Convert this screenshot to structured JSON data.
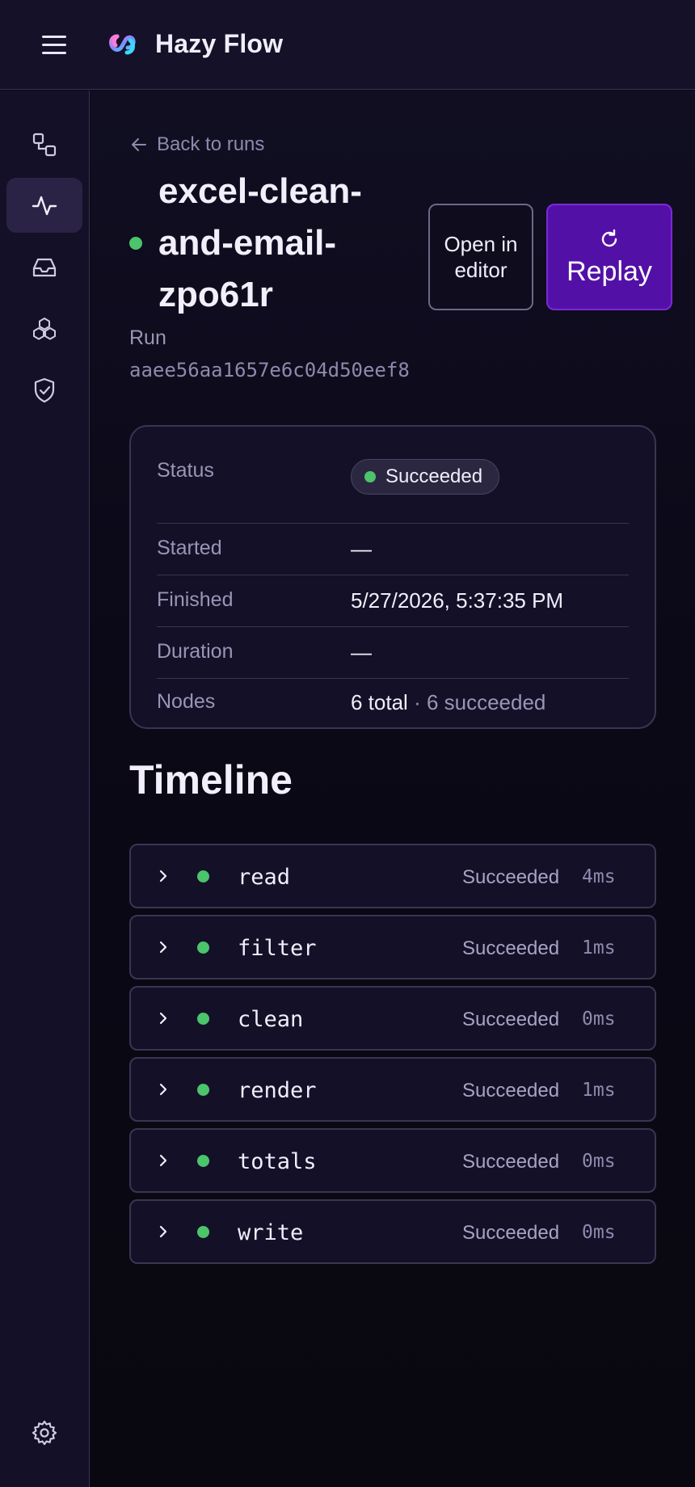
{
  "app": {
    "name": "Hazy Flow"
  },
  "sidebar": {
    "items": [
      {
        "icon": "workflows-icon",
        "label": "Workflows"
      },
      {
        "icon": "activity-icon",
        "label": "Runs",
        "active": true
      },
      {
        "icon": "inbox-icon",
        "label": "Inbox"
      },
      {
        "icon": "components-icon",
        "label": "Components"
      },
      {
        "icon": "shield-check-icon",
        "label": "Security"
      },
      {
        "icon": "gear-icon",
        "label": "Settings"
      }
    ]
  },
  "header": {
    "back_label": "Back to runs",
    "title": "excel-clean-and-email-zpo61r",
    "status_color": "#4bc46b",
    "open_editor_label": "Open in editor",
    "replay_label": "Replay",
    "run_label": "Run",
    "run_id": "aaee56aa1657e6c04d50eef8"
  },
  "details": {
    "status_key": "Status",
    "status_value": "Succeeded",
    "started_key": "Started",
    "started_value": "—",
    "finished_key": "Finished",
    "finished_value": "5/27/2026, 5:37:35 PM",
    "duration_key": "Duration",
    "duration_value": "—",
    "nodes_key": "Nodes",
    "nodes_total": "6 total",
    "nodes_succeeded": "· 6 succeeded"
  },
  "timeline": {
    "title": "Timeline",
    "items": [
      {
        "name": "read",
        "status": "Succeeded",
        "duration": "4ms"
      },
      {
        "name": "filter",
        "status": "Succeeded",
        "duration": "1ms"
      },
      {
        "name": "clean",
        "status": "Succeeded",
        "duration": "0ms"
      },
      {
        "name": "render",
        "status": "Succeeded",
        "duration": "1ms"
      },
      {
        "name": "totals",
        "status": "Succeeded",
        "duration": "0ms"
      },
      {
        "name": "write",
        "status": "Succeeded",
        "duration": "0ms"
      }
    ]
  },
  "colors": {
    "accent": "#5310a6",
    "success": "#4bc46b",
    "background": "#0a0814",
    "surface": "#141028"
  }
}
